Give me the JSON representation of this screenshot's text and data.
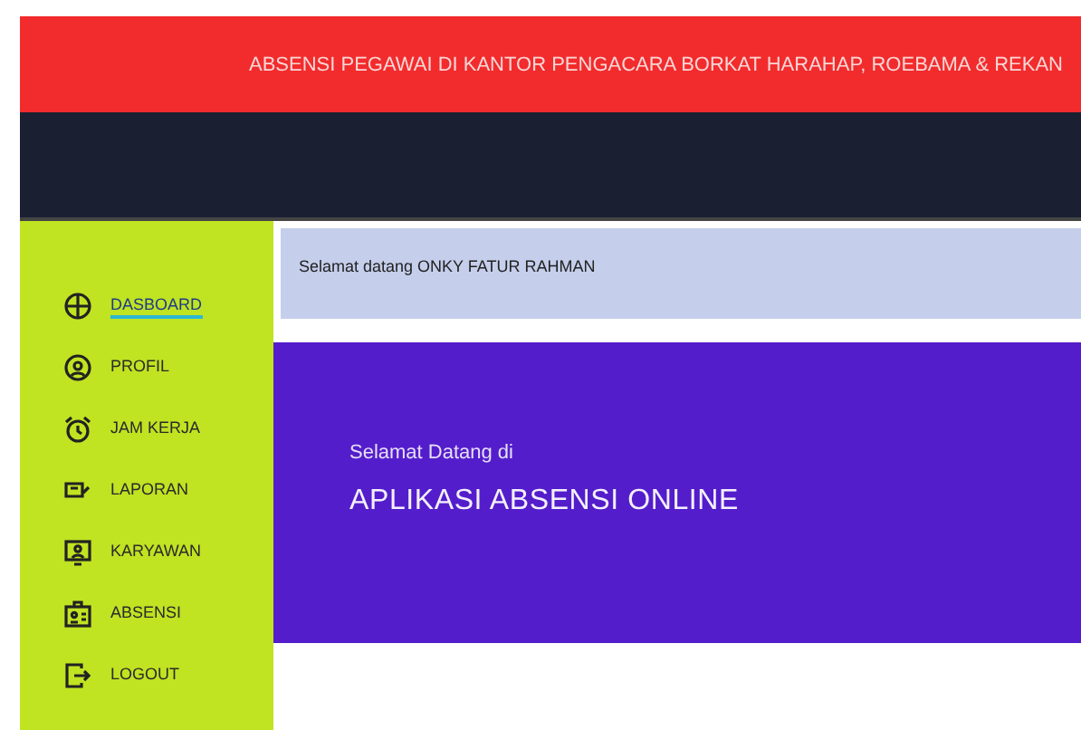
{
  "header": {
    "title": "ABSENSI PEGAWAI DI KANTOR PENGACARA BORKAT HARAHAP, ROEBAMA & REKAN"
  },
  "sidebar": {
    "items": [
      {
        "label": "DASBOARD",
        "selected": true
      },
      {
        "label": "PROFIL",
        "selected": false
      },
      {
        "label": "JAM KERJA",
        "selected": false
      },
      {
        "label": "LAPORAN",
        "selected": false
      },
      {
        "label": "KARYAWAN",
        "selected": false
      },
      {
        "label": "ABSENSI",
        "selected": false
      },
      {
        "label": "LOGOUT",
        "selected": false
      }
    ]
  },
  "welcome_bar": {
    "text": "Selamat datang ONKY FATUR RAHMAN"
  },
  "hero": {
    "subtitle": "Selamat Datang di",
    "title": "APLIKASI ABSENSI ONLINE"
  }
}
